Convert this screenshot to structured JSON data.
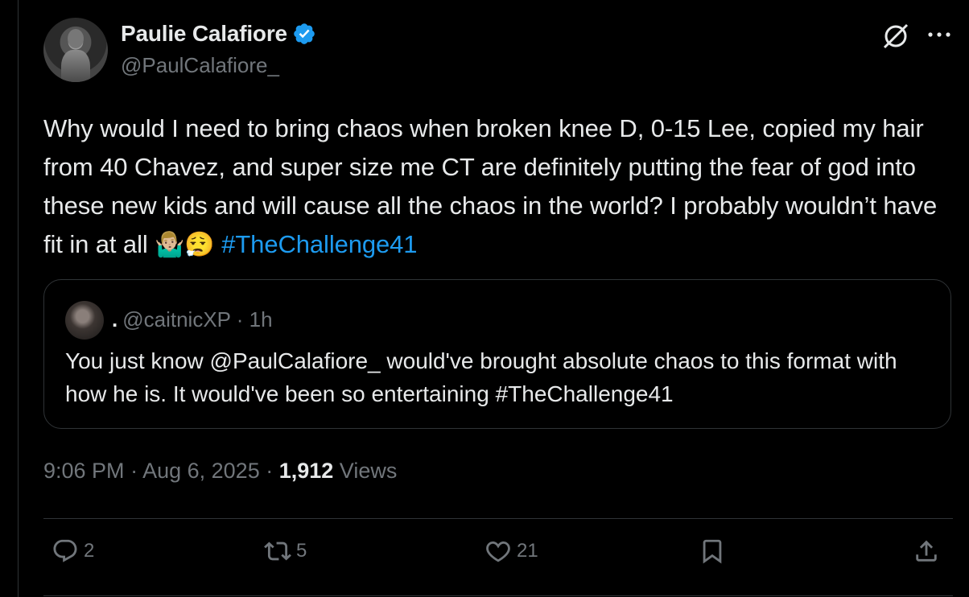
{
  "author": {
    "display_name": "Paulie Calafiore",
    "handle": "@PaulCalafiore_"
  },
  "tweet": {
    "text_main": "Why would I need to bring chaos when broken knee D, 0-15 Lee, copied my hair from 40 Chavez, and super size me CT are definitely putting the fear of god into these new kids and will cause all the chaos in the world? I probably wouldn’t have fit in at all ",
    "emojis": "🤷🏼‍♂️😮‍💨",
    "hashtag": "#TheChallenge41"
  },
  "quote": {
    "display_name": ".",
    "handle": "@caitnicXP",
    "separator": " · ",
    "time": "1h",
    "text": "You just know @PaulCalafiore_ would've brought absolute chaos to this format with how he is. It would've been so entertaining #TheChallenge41"
  },
  "meta": {
    "time": "9:06 PM",
    "sep1": " · ",
    "date": "Aug 6, 2025",
    "sep2": " · ",
    "views_count": "1,912",
    "views_label": " Views"
  },
  "actions": {
    "replies": "2",
    "reposts": "5",
    "likes": "21"
  },
  "colors": {
    "background": "#000000",
    "text": "#e7e9ea",
    "muted": "#71767b",
    "accent": "#1d9bf0",
    "border": "#2f3336"
  },
  "icons": [
    "verified-badge-icon",
    "grok-icon",
    "more-icon",
    "reply-icon",
    "repost-icon",
    "like-icon",
    "bookmark-icon",
    "share-icon"
  ]
}
